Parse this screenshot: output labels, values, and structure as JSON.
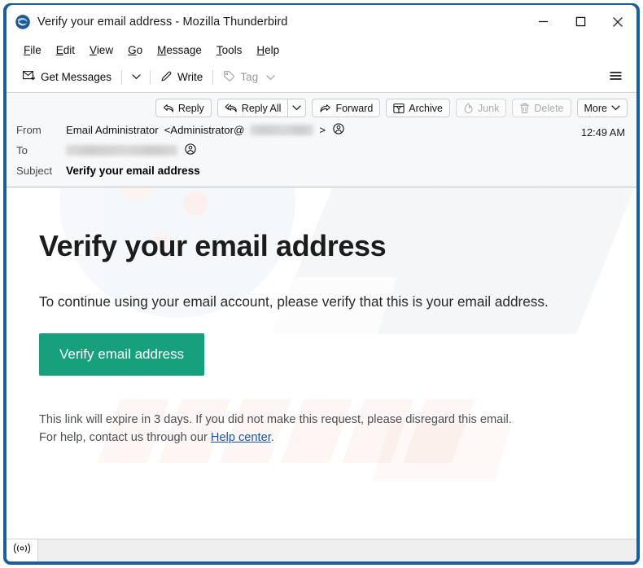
{
  "window": {
    "title": "Verify your email address - Mozilla Thunderbird",
    "app_icon": "thunderbird-icon",
    "controls": {
      "minimize": "minimize-icon",
      "maximize": "maximize-icon",
      "close": "close-icon"
    },
    "border_color": "#1b5e9e"
  },
  "menubar": {
    "items": [
      {
        "label": "File",
        "accesskey": "F"
      },
      {
        "label": "Edit",
        "accesskey": "E"
      },
      {
        "label": "View",
        "accesskey": "V"
      },
      {
        "label": "Go",
        "accesskey": "G"
      },
      {
        "label": "Message",
        "accesskey": "M"
      },
      {
        "label": "Tools",
        "accesskey": "T"
      },
      {
        "label": "Help",
        "accesskey": "H"
      }
    ]
  },
  "toolbar": {
    "get_messages": "Get Messages",
    "get_messages_icon": "envelope-download-icon",
    "get_messages_chevron": "chevron-down-icon",
    "write": "Write",
    "write_icon": "pencil-icon",
    "tag": "Tag",
    "tag_icon": "tag-icon",
    "tag_chevron": "chevron-down-icon",
    "tag_disabled": true,
    "app_menu_icon": "hamburger-menu-icon"
  },
  "message_actions": {
    "reply": "Reply",
    "reply_icon": "reply-arrow-icon",
    "reply_all": "Reply All",
    "reply_all_icon": "reply-all-arrow-icon",
    "reply_all_chevron": "chevron-down-icon",
    "forward": "Forward",
    "forward_icon": "forward-arrow-icon",
    "archive": "Archive",
    "archive_icon": "archive-box-icon",
    "junk": "Junk",
    "junk_icon": "flame-icon",
    "junk_disabled": true,
    "delete": "Delete",
    "delete_icon": "trash-icon",
    "delete_disabled": true,
    "more": "More",
    "more_chevron": "chevron-down-icon"
  },
  "message_header": {
    "from_label": "From",
    "from_display_name": "Email Administrator",
    "from_address_prefix": "<Administrator@",
    "from_address_suffix": ">",
    "from_address_redacted": true,
    "from_contact_icon": "contact-circle-icon",
    "to_label": "To",
    "to_address_redacted": true,
    "to_contact_icon": "contact-circle-icon",
    "subject_label": "Subject",
    "subject_value": "Verify your email address",
    "time": "12:49 AM"
  },
  "email": {
    "heading": "Verify your email address",
    "lead": "To continue using your email account, please verify that this is your email address.",
    "cta_label": "Verify email address",
    "cta_color": "#17a07c",
    "footer_line1": "This link will expire in 3 days. If you did not make this request, please disregard this email.",
    "footer_line2_before": "For help, contact us through our ",
    "footer_link": "Help center",
    "footer_line2_after": ".",
    "link_color": "#1955a8"
  },
  "statusbar": {
    "indicator_icon": "broadcast-signal-icon"
  }
}
